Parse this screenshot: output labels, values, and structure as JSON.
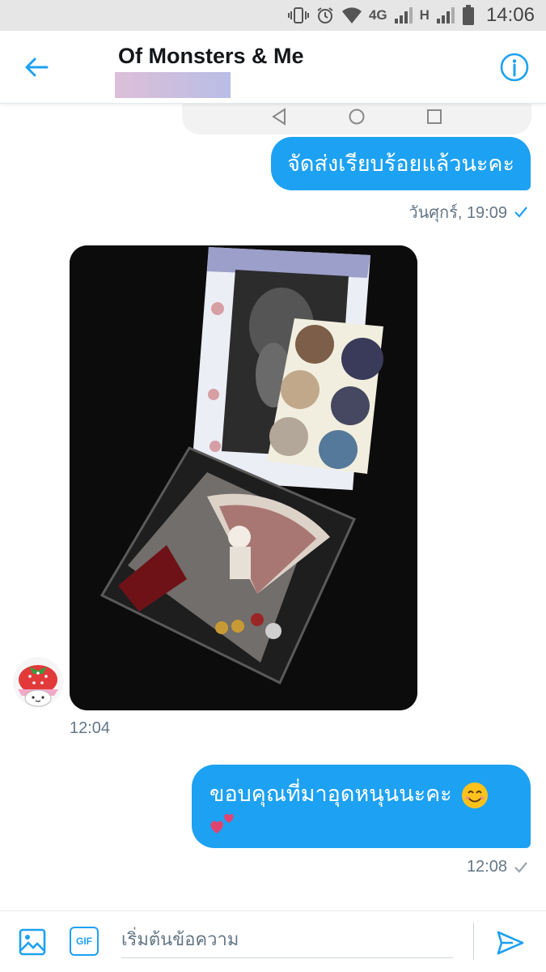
{
  "status_bar": {
    "network_label": "4G",
    "network_label_2": "H",
    "time": "14:06",
    "icons": [
      "vibrate-icon",
      "alarm-icon",
      "wifi-icon",
      "signal-icon",
      "signal-icon",
      "battery-icon"
    ]
  },
  "header": {
    "title": "Of Monsters & Me",
    "back_icon": "arrow-left-icon",
    "info_icon": "info-icon"
  },
  "colors": {
    "accent": "#1da1f2",
    "timestamp": "#657786",
    "status_bar_bg": "#e6e6e6"
  },
  "messages": [
    {
      "type": "text",
      "direction": "sent",
      "text": "จัดส่งเรียบร้อยแล้วนะคะ",
      "time": "วันศุกร์, 19:09",
      "status_icon": "check-icon"
    },
    {
      "type": "image",
      "direction": "received",
      "time": "12:04",
      "avatar_icon": "strawberry-avatar-icon"
    },
    {
      "type": "text",
      "direction": "sent",
      "text": "ขอบคุณที่มาอุดหนุนนะคะ",
      "emoji": [
        "smiling-face-emoji",
        "two-hearts-emoji"
      ],
      "time": "12:08",
      "status_icon": "check-icon"
    }
  ],
  "composer": {
    "placeholder": "เริ่มต้นข้อความ",
    "gif_label": "GIF",
    "media_icon": "image-icon",
    "send_icon": "send-icon"
  }
}
